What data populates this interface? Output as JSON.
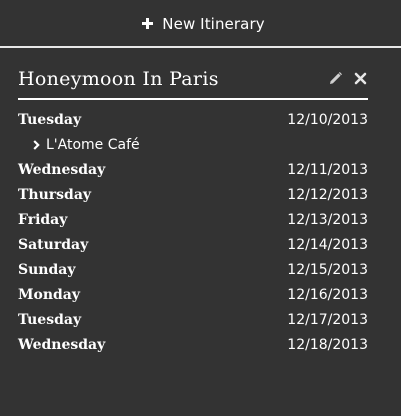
{
  "toolbar": {
    "new_label": "New Itinerary"
  },
  "itinerary": {
    "title": "Honeymoon In Paris",
    "edit_icon": "pencil-icon",
    "delete_icon": "close-icon",
    "days": [
      {
        "day": "Tuesday",
        "date": "12/10/2013",
        "places": [
          "L'Atome Café"
        ]
      },
      {
        "day": "Wednesday",
        "date": "12/11/2013",
        "places": []
      },
      {
        "day": "Thursday",
        "date": "12/12/2013",
        "places": []
      },
      {
        "day": "Friday",
        "date": "12/13/2013",
        "places": []
      },
      {
        "day": "Saturday",
        "date": "12/14/2013",
        "places": []
      },
      {
        "day": "Sunday",
        "date": "12/15/2013",
        "places": []
      },
      {
        "day": "Monday",
        "date": "12/16/2013",
        "places": []
      },
      {
        "day": "Tuesday",
        "date": "12/17/2013",
        "places": []
      },
      {
        "day": "Wednesday",
        "date": "12/18/2013",
        "places": []
      }
    ]
  },
  "colors": {
    "background": "#333333",
    "text": "#ffffff",
    "rule": "#e8e8e8"
  }
}
